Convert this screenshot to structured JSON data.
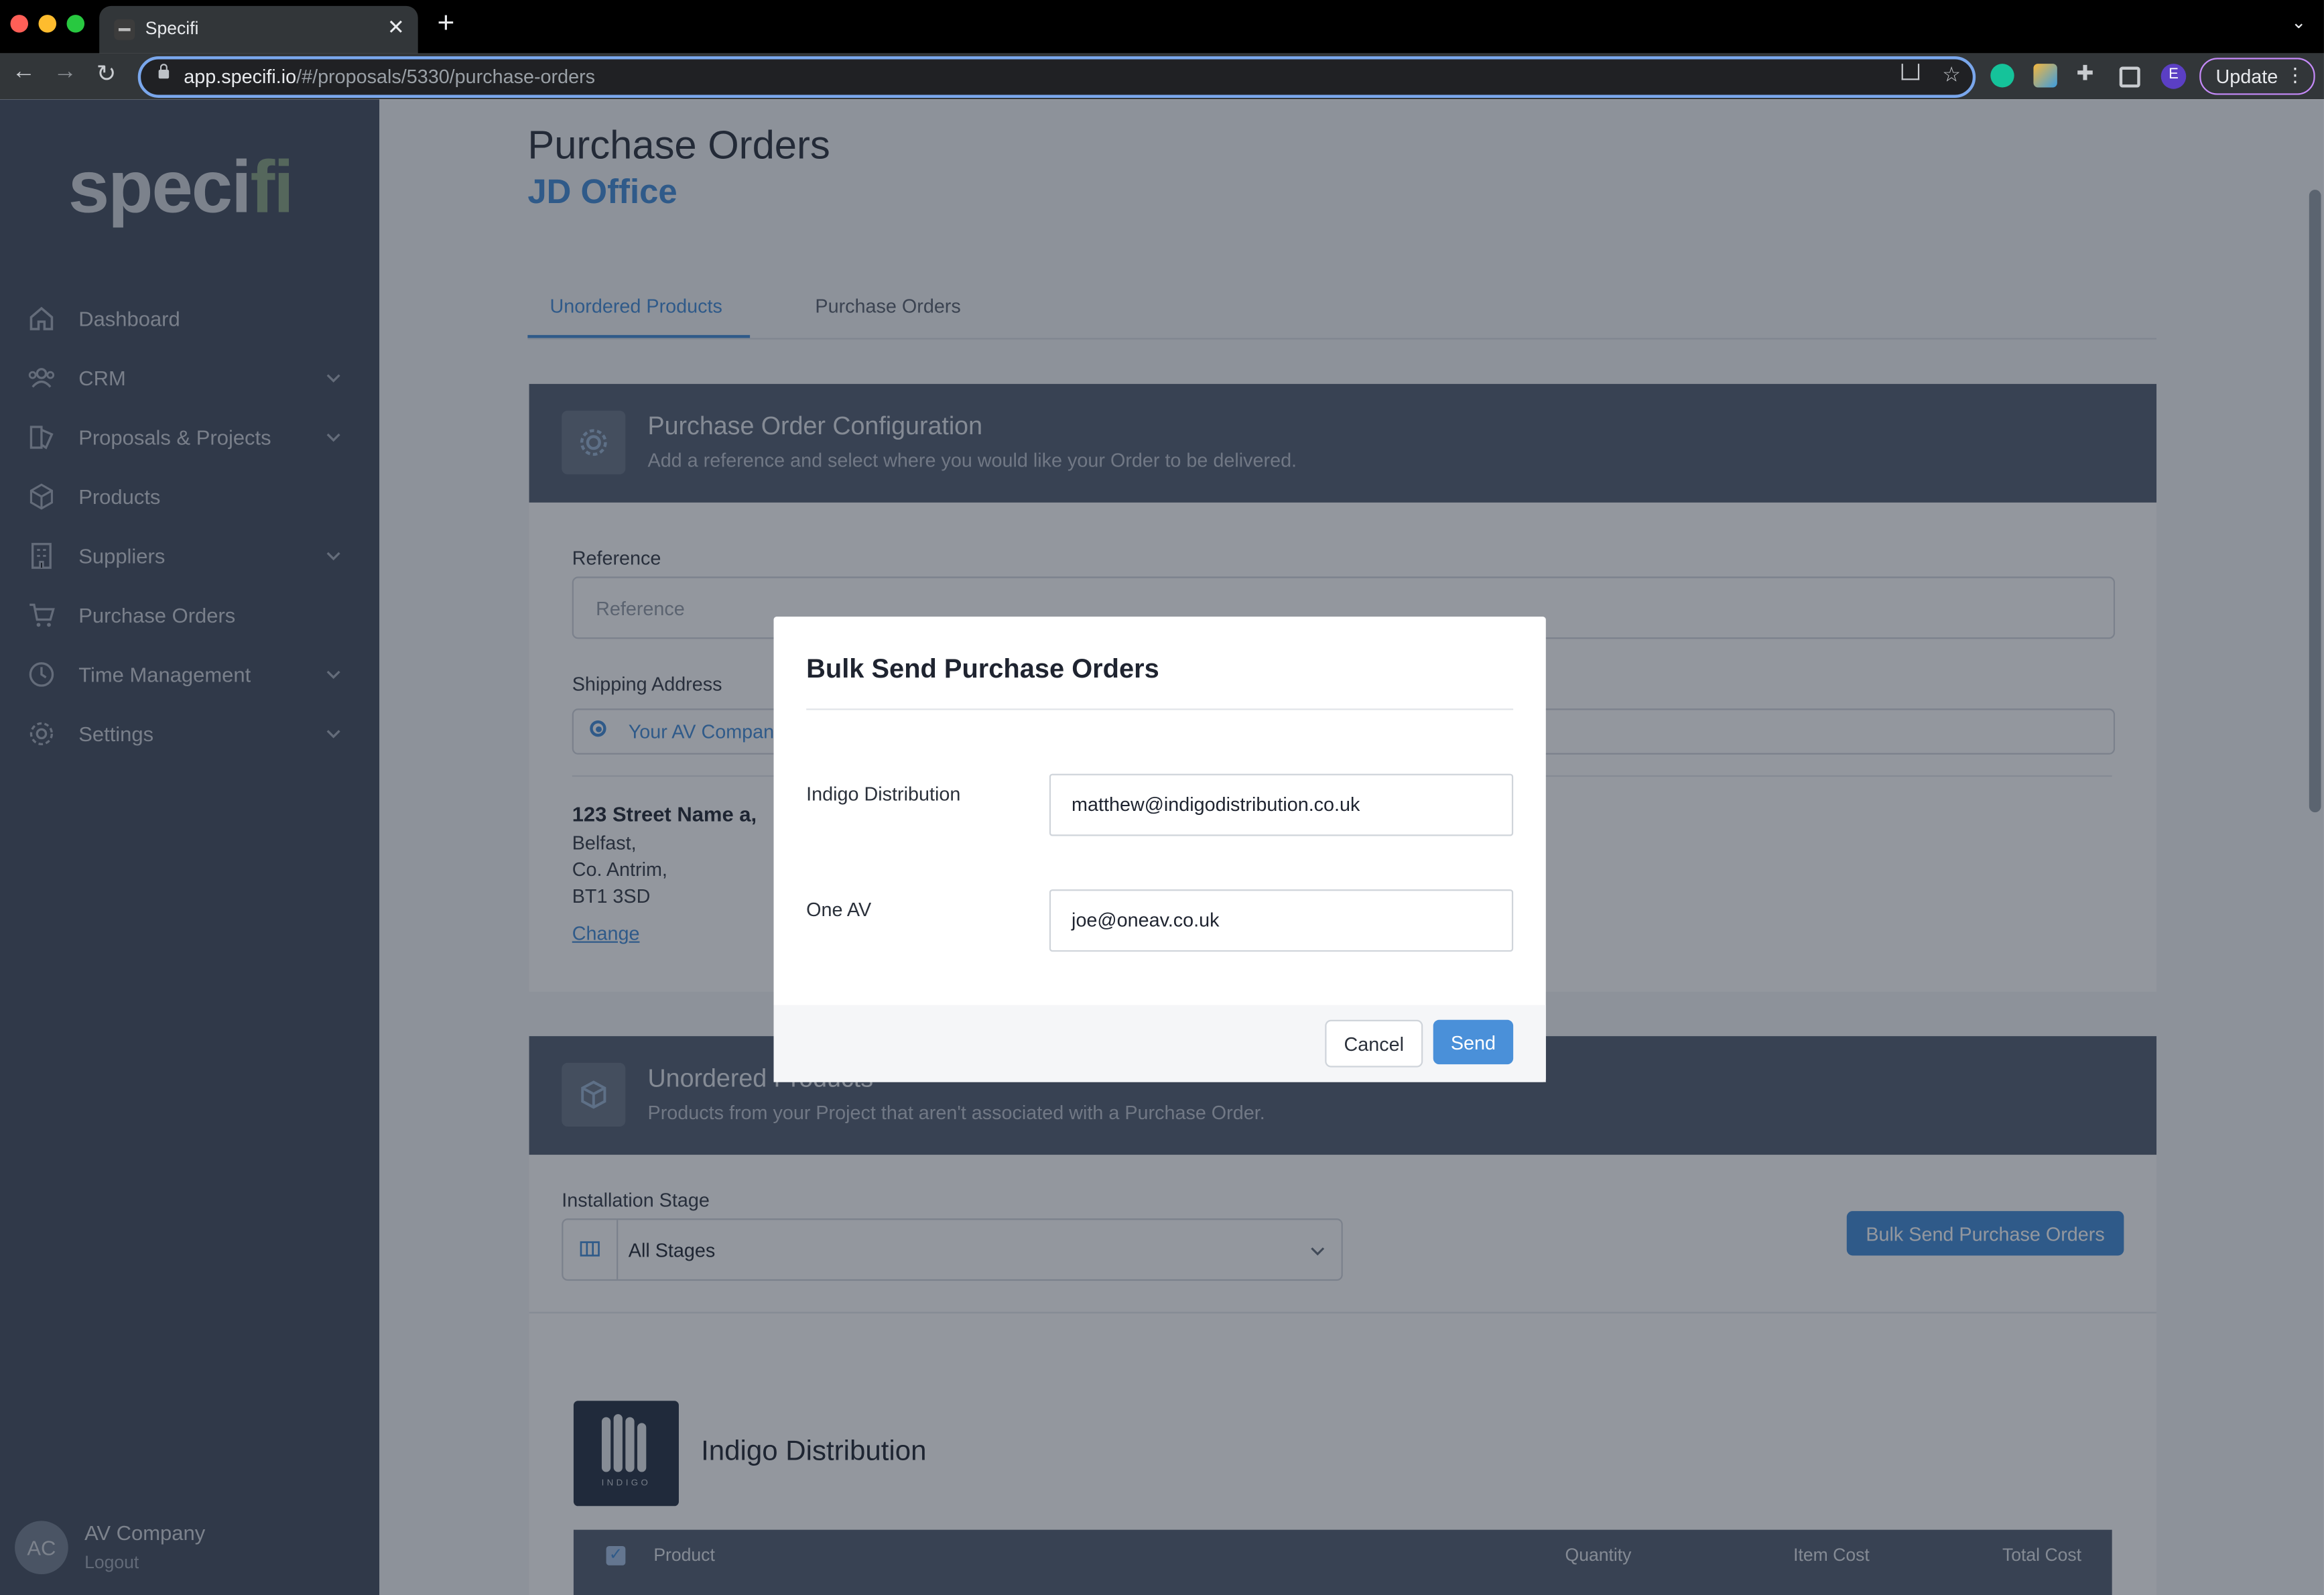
{
  "browser": {
    "tab_title": "Specifi",
    "url_host": "app.specifi.io",
    "url_path": "/#/proposals/5330/purchase-orders",
    "update_label": "Update",
    "profile_initial": "E"
  },
  "sidebar": {
    "logo_main": "speci",
    "logo_accent": "fi",
    "items": [
      {
        "label": "Dashboard",
        "icon": "home-icon",
        "has_chevron": false
      },
      {
        "label": "CRM",
        "icon": "users-icon",
        "has_chevron": true
      },
      {
        "label": "Proposals & Projects",
        "icon": "proposals-icon",
        "has_chevron": true
      },
      {
        "label": "Products",
        "icon": "cube-icon",
        "has_chevron": false
      },
      {
        "label": "Suppliers",
        "icon": "building-icon",
        "has_chevron": true
      },
      {
        "label": "Purchase Orders",
        "icon": "cart-icon",
        "has_chevron": false
      },
      {
        "label": "Time Management",
        "icon": "clock-icon",
        "has_chevron": true
      },
      {
        "label": "Settings",
        "icon": "gear-icon",
        "has_chevron": true
      }
    ],
    "user": {
      "initials": "AC",
      "name": "AV Company",
      "logout": "Logout"
    }
  },
  "page": {
    "title": "Purchase Orders",
    "subtitle": "JD Office",
    "tabs": [
      "Unordered Products",
      "Purchase Orders"
    ],
    "config": {
      "title": "Purchase Order Configuration",
      "subtitle": "Add a reference and select where you would like your Order to be delivered.",
      "reference_label": "Reference",
      "reference_placeholder": "Reference",
      "shipping_label": "Shipping Address",
      "shipping_option": "Your AV Company",
      "address_line1": "123 Street Name a,",
      "address_line2": "Belfast,",
      "address_line3": "Co. Antrim,",
      "address_line4": "BT1 3SD",
      "change_link": "Change"
    },
    "unordered": {
      "title": "Unordered Products",
      "subtitle": "Products from your Project that aren't associated with a Purchase Order.",
      "stage_label": "Installation Stage",
      "stage_value": "All Stages",
      "bulk_button": "Bulk Send Purchase Orders",
      "supplier_name": "Indigo Distribution",
      "supplier_logo_text": "INDIGO",
      "columns": [
        "Product",
        "Quantity",
        "Item Cost",
        "Total Cost"
      ]
    }
  },
  "modal": {
    "title": "Bulk Send Purchase Orders",
    "rows": [
      {
        "supplier": "Indigo Distribution",
        "email": "matthew@indigodistribution.co.uk"
      },
      {
        "supplier": "One AV",
        "email": "joe@oneav.co.uk"
      }
    ],
    "cancel_label": "Cancel",
    "send_label": "Send"
  },
  "colors": {
    "accent": "#4a90d9",
    "sidebar": "#4c5565",
    "card_header": "#5a6577"
  }
}
